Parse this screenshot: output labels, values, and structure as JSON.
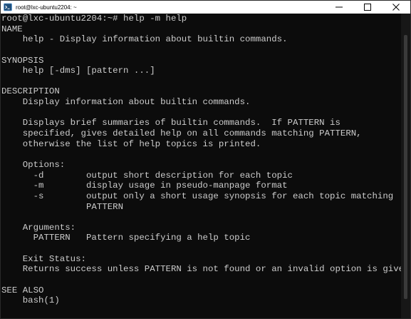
{
  "window": {
    "title": "root@lxc-ubuntu2204: ~",
    "icons": {
      "app": "terminal-app-icon",
      "minimize": "minimize-icon",
      "maximize": "maximize-icon",
      "close": "close-icon"
    }
  },
  "terminal": {
    "lines": [
      "root@lxc-ubuntu2204:~# help -m help",
      "NAME",
      "    help - Display information about builtin commands.",
      "",
      "SYNOPSIS",
      "    help [-dms] [pattern ...]",
      "",
      "DESCRIPTION",
      "    Display information about builtin commands.",
      "",
      "    Displays brief summaries of builtin commands.  If PATTERN is",
      "    specified, gives detailed help on all commands matching PATTERN,",
      "    otherwise the list of help topics is printed.",
      "",
      "    Options:",
      "      -d        output short description for each topic",
      "      -m        display usage in pseudo-manpage format",
      "      -s        output only a short usage synopsis for each topic matching",
      "                PATTERN",
      "",
      "    Arguments:",
      "      PATTERN   Pattern specifying a help topic",
      "",
      "    Exit Status:",
      "    Returns success unless PATTERN is not found or an invalid option is given.",
      "",
      "SEE ALSO",
      "    bash(1)",
      "",
      ""
    ]
  },
  "colors": {
    "terminal_bg": "#0c0c0c",
    "terminal_fg": "#cccccc",
    "titlebar_bg": "#ffffff"
  }
}
